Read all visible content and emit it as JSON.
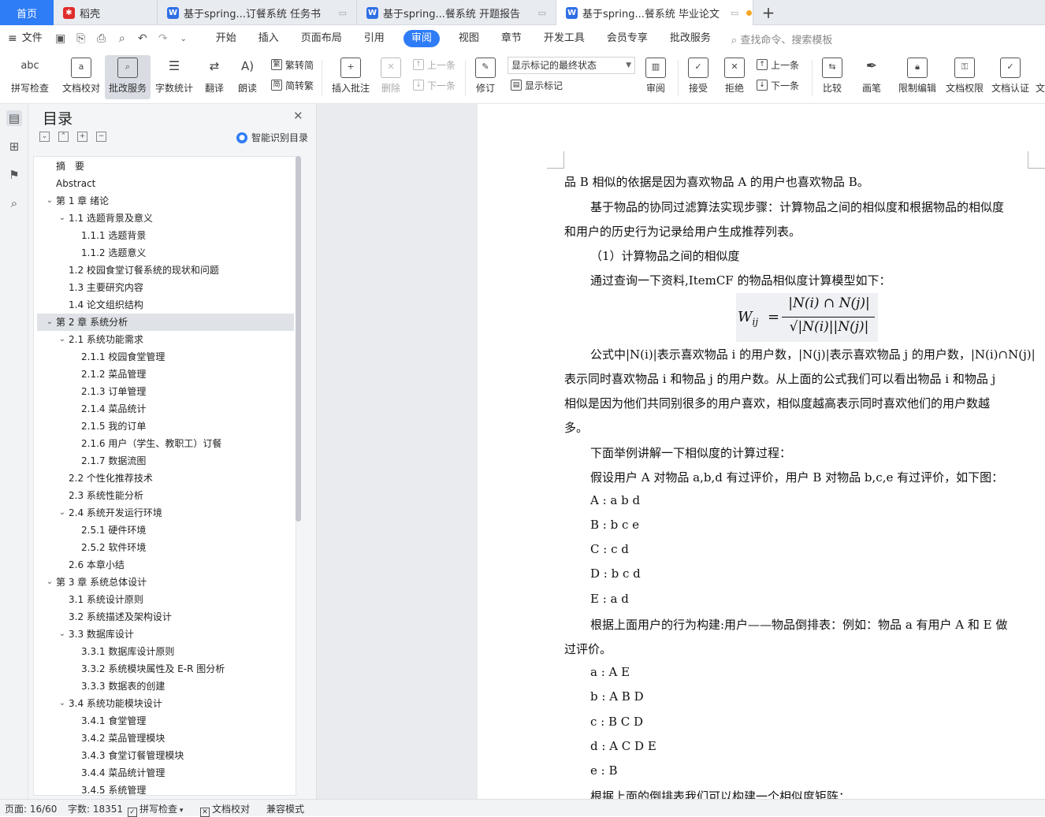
{
  "tabs": {
    "home": "首页",
    "app": "稻壳",
    "doc1": "基于spring...订餐系统 任务书",
    "doc2": "基于spring...餐系统 开题报告",
    "doc3": "基于spring...餐系统 毕业论文",
    "add": "+"
  },
  "menu": {
    "file": "文件",
    "tabs": [
      "开始",
      "插入",
      "页面布局",
      "引用",
      "审阅",
      "视图",
      "章节",
      "开发工具",
      "会员专享",
      "批改服务"
    ],
    "search": "查找命令、搜索模板"
  },
  "ribbon": {
    "spell": "拼写检查",
    "proof": "文档校对",
    "correct": "批改服务",
    "wordcount": "字数统计",
    "translate": "翻译",
    "read": "朗读",
    "to_simp": "繁转简",
    "to_trad": "简转繁",
    "insert_comment": "插入批注",
    "delete": "删除",
    "prev1": "上一条",
    "next1": "下一条",
    "track": "修订",
    "show_state": "显示标记的最终状态",
    "show_marks": "显示标记",
    "review": "审阅",
    "accept": "接受",
    "reject": "拒绝",
    "prev2": "上一条",
    "next2": "下一条",
    "compare": "比较",
    "pen": "画笔",
    "restrict": "限制编辑",
    "perm": "文档权限",
    "cert": "文档认证",
    "more": "文"
  },
  "toc": {
    "title": "目录",
    "smart": "智能识别目录",
    "items": [
      "摘　要",
      "Abstract",
      "第 1 章  绪论",
      "1.1  选题背景及意义",
      "1.1.1 选题背景",
      "1.1.2 选题意义",
      "1.2  校园食堂订餐系统的现状和问题",
      "1.3  主要研究内容",
      "1.4  论文组织结构",
      "第 2 章  系统分析",
      "2.1  系统功能需求",
      "2.1.1  校园食堂管理",
      "2.1.2  菜品管理",
      "2.1.3  订单管理",
      "2.1.4  菜品统计",
      "2.1.5  我的订单",
      "2.1.6  用户（学生、教职工）订餐",
      "2.1.7  数据流图",
      "2.2  个性化推荐技术",
      "2.3  系统性能分析",
      "2.4  系统开发运行环境",
      "2.5.1  硬件环境",
      "2.5.2  软件环境",
      "2.6  本章小结",
      "第 3 章  系统总体设计",
      "3.1  系统设计原则",
      "3.2  系统描述及架构设计",
      "3.3  数据库设计",
      "3.3.1  数据库设计原则",
      "3.3.2  系统模块属性及 E-R 图分析",
      "3.3.3  数据表的创建",
      "3.4  系统功能模块设计",
      "3.4.1  食堂管理",
      "3.4.2  菜品管理模块",
      "3.4.3  食堂订餐管理模块",
      "3.4.4  菜品统计管理",
      "3.4.5  系统管理"
    ]
  },
  "doc": {
    "lines": [
      "品 B 相似的依据是因为喜欢物品 A 的用户也喜欢物品 B。",
      "基于物品的协同过滤算法实现步骤：计算物品之间的相似度和根据物品的相似度",
      "和用户的历史行为记录给用户生成推荐列表。",
      "（1）计算物品之间的相似度",
      "通过查询一下资料,ItemCF 的物品相似度计算模型如下：",
      "公式中|N(i)|表示喜欢物品 i 的用户数，|N(j)|表示喜欢物品 j 的用户数，|N(i)∩N(j)|",
      "表示同时喜欢物品 i 和物品 j 的用户数。从上面的公式我们可以看出物品 i 和物品 j",
      "相似是因为他们共同别很多的用户喜欢，相似度越高表示同时喜欢他们的用户数越",
      "多。",
      "下面举例讲解一下相似度的计算过程：",
      "假设用户 A 对物品 a,b,d 有过评价，用户 B 对物品 b,c,e 有过评价，如下图：",
      "A : a b d",
      "B : b c e",
      "C : c d",
      "D : b c d",
      "E : a d",
      "根据上面用户的行为构建:用户——物品倒排表：例如：物品 a 有用户 A 和 E 做",
      "过评价。",
      "a : A E",
      "b : A B D",
      "c : B C D",
      "d : A C D E",
      "e : B",
      "根据上面的倒排表我们可以构建一个相似度矩阵："
    ],
    "formula": {
      "lhs": "W",
      "sub": "ij",
      "eq": "=",
      "numerator": "|N(i) ∩ N(j)|",
      "denominator": "√|N(i)||N(j)|"
    }
  },
  "status": {
    "page": "页面: 16/60",
    "words": "字数: 18351",
    "spell": "拼写检查",
    "proof": "文档校对",
    "compat": "兼容模式"
  },
  "colors": {
    "accent": "#2e7cf6",
    "wps_doc": "#2f6fe6",
    "docer": "#e02b2b"
  }
}
